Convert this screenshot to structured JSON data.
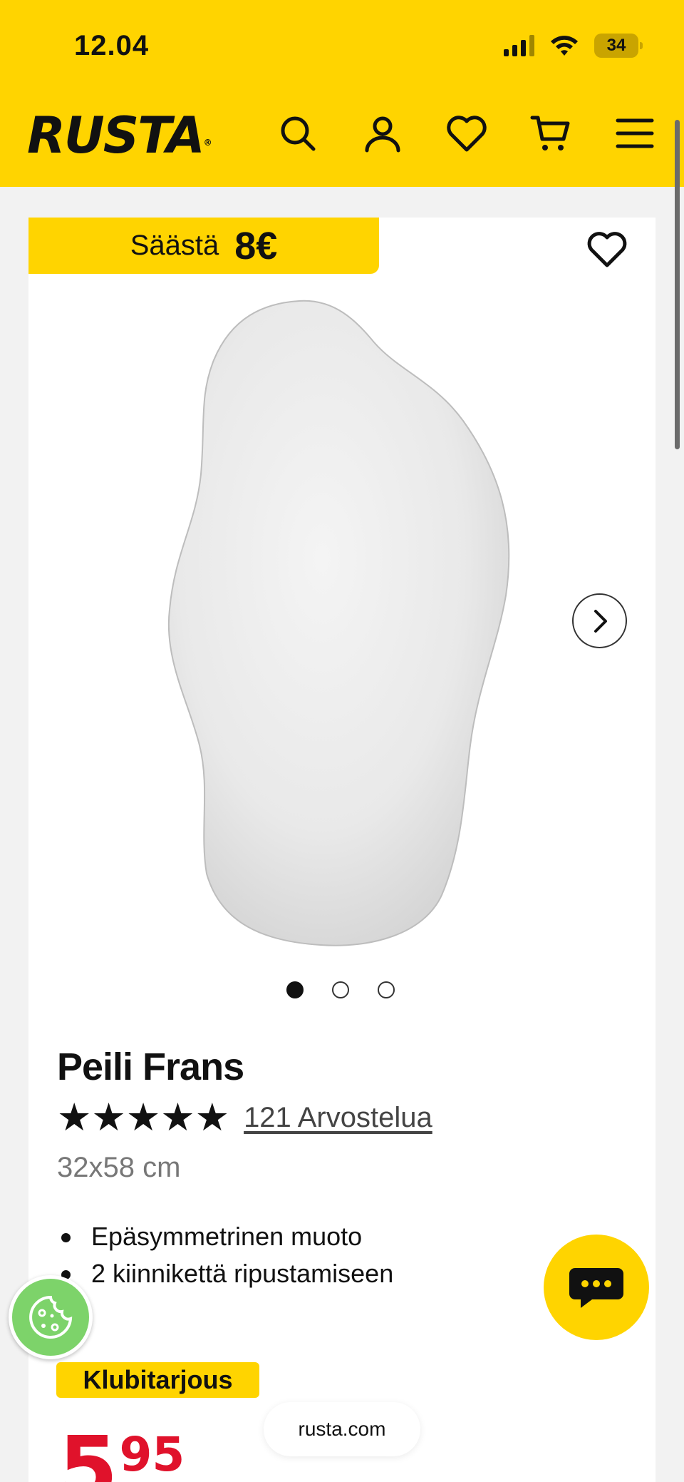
{
  "status_bar": {
    "time": "12.04",
    "battery": "34",
    "icons": [
      "signal-icon",
      "wifi-icon",
      "battery-icon"
    ]
  },
  "header": {
    "logo": "RUSTA",
    "icons": [
      "search-icon",
      "account-icon",
      "wishlist-icon",
      "cart-icon",
      "menu-icon"
    ]
  },
  "product": {
    "save_label": "Säästä",
    "save_amount": "8€",
    "title": "Peili Frans",
    "rating": 5,
    "rating_stars": "★★★★★",
    "reviews": "121 Arvostelua",
    "size": "32x58 cm",
    "features": [
      "Epäsymmetrinen muoto",
      "2 kiinnikettä ripustamiseen"
    ],
    "image_count": 3,
    "active_image": 1,
    "badge": "Klubitarjous",
    "price_int": "5",
    "price_dec": "95"
  },
  "browser": {
    "url": "rusta.com"
  },
  "colors": {
    "brand_yellow": "#ffd400",
    "price_red": "#e0122b",
    "cookie_green": "#7dd36a"
  }
}
